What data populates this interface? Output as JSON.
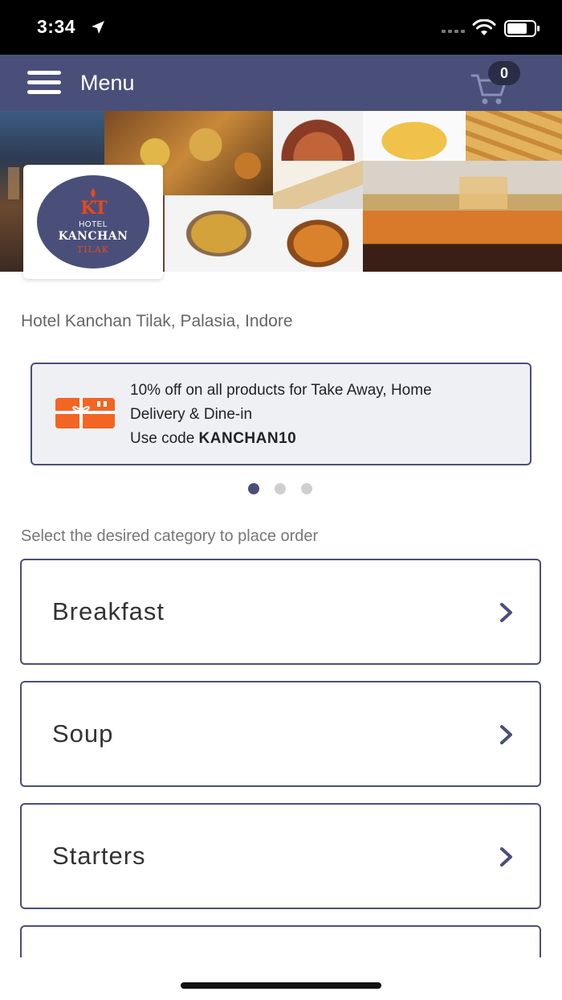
{
  "status_bar": {
    "time": "3:34",
    "icons": [
      "location-arrow-icon",
      "signal-icon",
      "wifi-icon",
      "battery-icon"
    ]
  },
  "nav": {
    "menu_icon": "hamburger-icon",
    "title": "Menu",
    "cart_icon": "cart-icon",
    "cart_count": "0",
    "background": "#4a4f7a"
  },
  "banner": {
    "logo": {
      "mark": "KT",
      "line1": "HOTEL",
      "line2": "KANCHAN",
      "line3": "TILAK"
    }
  },
  "restaurant": {
    "address": "Hotel Kanchan Tilak, Palasia, Indore"
  },
  "offer": {
    "icon": "offers-gift-icon",
    "line1": "10% off on all products for Take Away, Home",
    "line2": "Delivery & Dine-in",
    "code_prefix": "Use code ",
    "code": "KANCHAN10"
  },
  "carousel": {
    "active_index": 0,
    "count": 3
  },
  "categories": {
    "prompt": "Select the desired category to place order",
    "items": [
      {
        "label": "Breakfast"
      },
      {
        "label": "Soup"
      },
      {
        "label": "Starters"
      },
      {
        "label": ""
      }
    ]
  },
  "colors": {
    "accent": "#4a4f7a",
    "brand_orange": "#e64a19",
    "offer_orange": "#f26522"
  }
}
